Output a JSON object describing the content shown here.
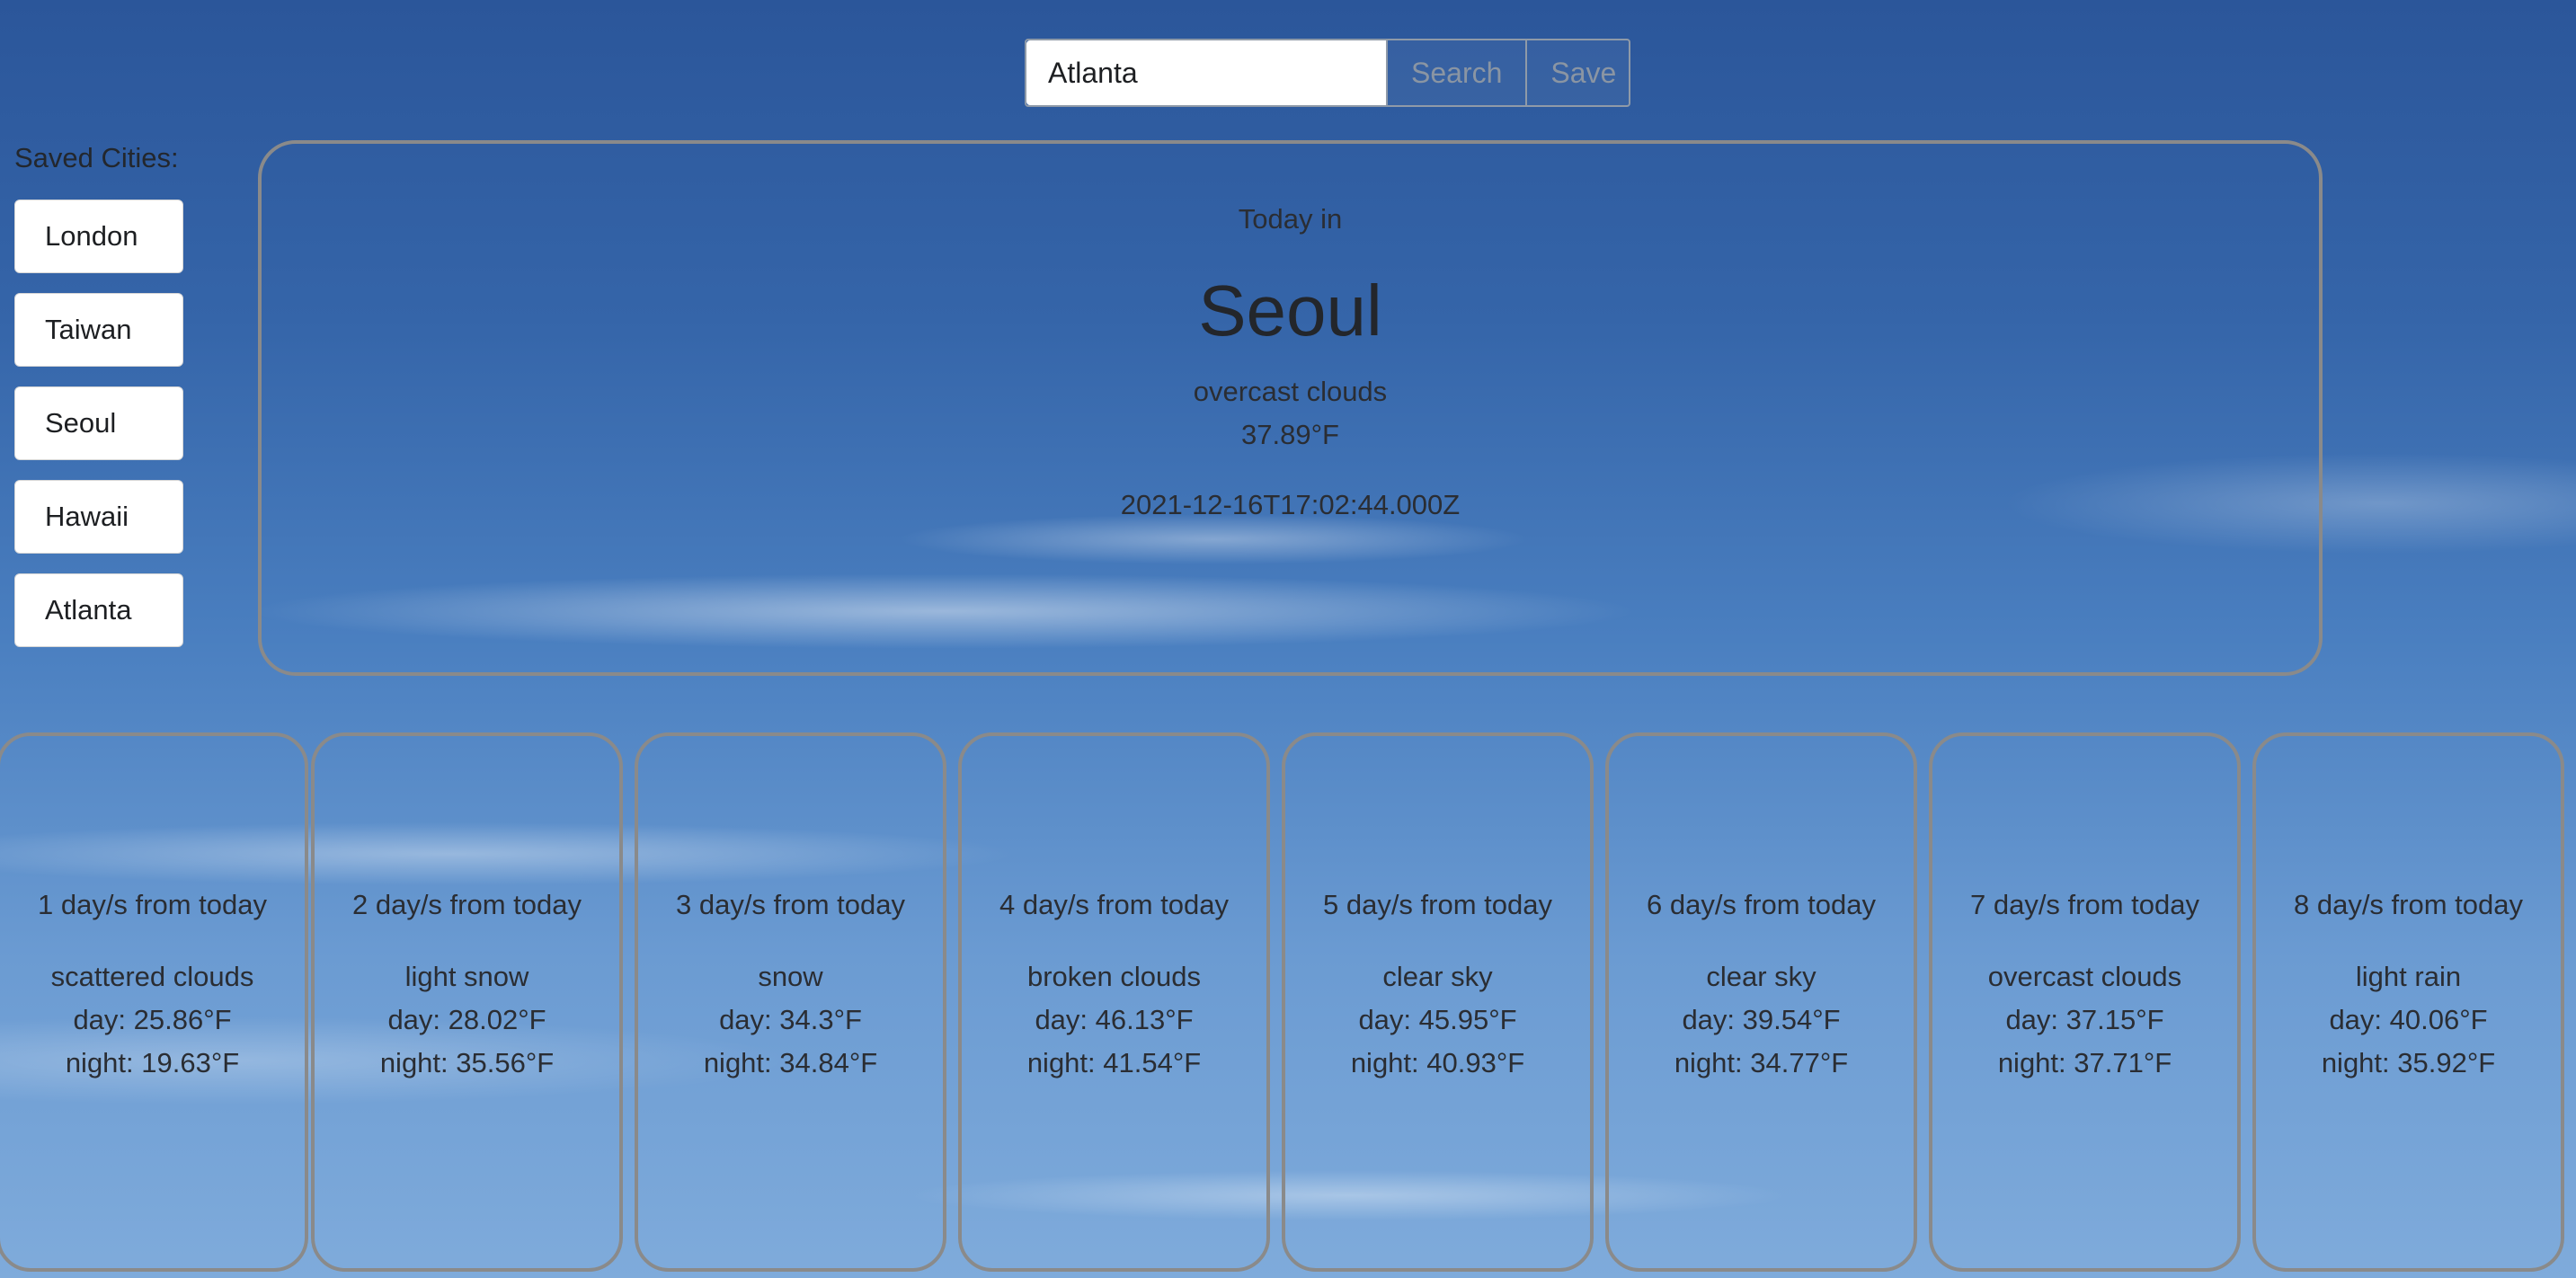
{
  "search": {
    "value": "Atlanta",
    "search_label": "Search",
    "save_label": "Save"
  },
  "saved": {
    "label": "Saved Cities:",
    "cities": [
      "London",
      "Taiwan",
      "Seoul",
      "Hawaii",
      "Atlanta"
    ]
  },
  "today": {
    "label": "Today in",
    "city": "Seoul",
    "description": "overcast clouds",
    "temperature": "37.89°F",
    "timestamp": "2021-12-16T17:02:44.000Z"
  },
  "forecast": [
    {
      "days": "1 day/s from today",
      "description": "scattered clouds",
      "day": "day: 25.86°F",
      "night": "night: 19.63°F"
    },
    {
      "days": "2 day/s from today",
      "description": "light snow",
      "day": "day: 28.02°F",
      "night": "night: 35.56°F"
    },
    {
      "days": "3 day/s from today",
      "description": "snow",
      "day": "day: 34.3°F",
      "night": "night: 34.84°F"
    },
    {
      "days": "4 day/s from today",
      "description": "broken clouds",
      "day": "day: 46.13°F",
      "night": "night: 41.54°F"
    },
    {
      "days": "5 day/s from today",
      "description": "clear sky",
      "day": "day: 45.95°F",
      "night": "night: 40.93°F"
    },
    {
      "days": "6 day/s from today",
      "description": "clear sky",
      "day": "day: 39.54°F",
      "night": "night: 34.77°F"
    },
    {
      "days": "7 day/s from today",
      "description": "overcast clouds",
      "day": "day: 37.15°F",
      "night": "night: 37.71°F"
    },
    {
      "days": "8 day/s from today",
      "description": "light rain",
      "day": "day: 40.06°F",
      "night": "night: 35.92°F"
    }
  ]
}
